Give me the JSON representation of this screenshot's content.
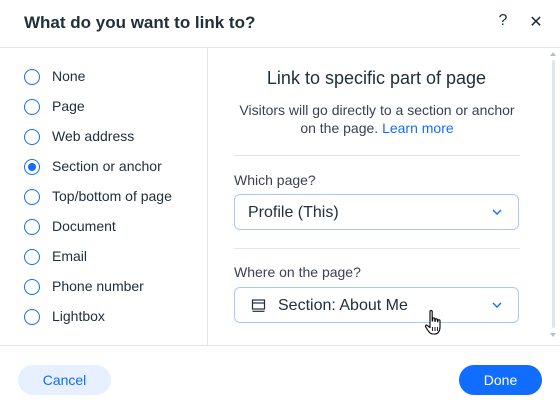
{
  "dialog": {
    "title": "What do you want to link to?",
    "help_icon": "question-mark",
    "close_icon": "close-x"
  },
  "link_types": [
    {
      "label": "None",
      "selected": false
    },
    {
      "label": "Page",
      "selected": false
    },
    {
      "label": "Web address",
      "selected": false
    },
    {
      "label": "Section or anchor",
      "selected": true
    },
    {
      "label": "Top/bottom of page",
      "selected": false
    },
    {
      "label": "Document",
      "selected": false
    },
    {
      "label": "Email",
      "selected": false
    },
    {
      "label": "Phone number",
      "selected": false
    },
    {
      "label": "Lightbox",
      "selected": false
    }
  ],
  "panel": {
    "title": "Link to specific part of page",
    "description": "Visitors will go directly to a section or anchor on the page.",
    "learn_more": "Learn more",
    "which_page": {
      "label": "Which page?",
      "value": "Profile (This)"
    },
    "where_on_page": {
      "label": "Where on the page?",
      "value": "Section: About Me",
      "icon": "section-icon"
    }
  },
  "footer": {
    "cancel_label": "Cancel",
    "done_label": "Done"
  },
  "colors": {
    "accent": "#116dff",
    "accent_light": "#e7f0ff",
    "text": "#20303c",
    "border": "#dfe5eb"
  }
}
